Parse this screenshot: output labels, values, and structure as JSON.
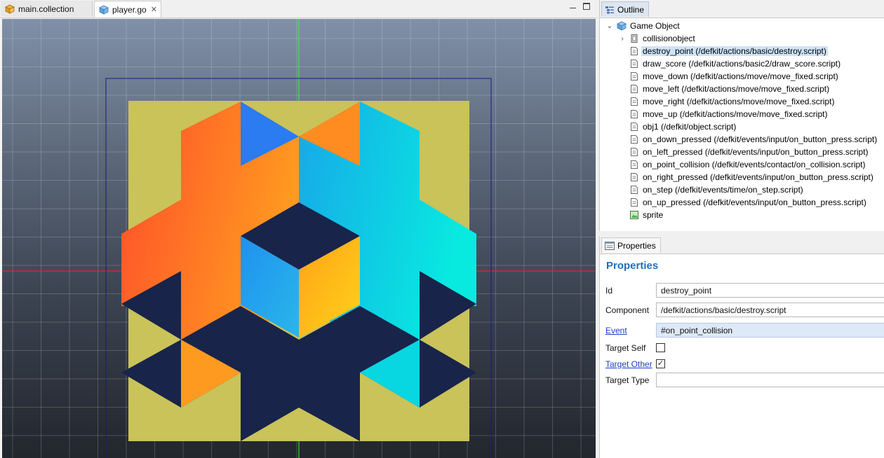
{
  "editor": {
    "tabs": [
      {
        "label": "main.collection",
        "icon": "collection-icon",
        "active": false
      },
      {
        "label": "player.go",
        "icon": "gameobject-icon",
        "active": true,
        "close": "✕"
      }
    ]
  },
  "outline": {
    "tab_label": "Outline",
    "root": "Game Object",
    "items": [
      {
        "label": "collisionobject",
        "icon": "collision-object-icon",
        "expandable": true
      },
      {
        "label": "destroy_point (/defkit/actions/basic/destroy.script)",
        "icon": "script-icon",
        "selected": true
      },
      {
        "label": "draw_score (/defkit/actions/basic2/draw_score.script)",
        "icon": "script-icon"
      },
      {
        "label": "move_down (/defkit/actions/move/move_fixed.script)",
        "icon": "script-icon"
      },
      {
        "label": "move_left (/defkit/actions/move/move_fixed.script)",
        "icon": "script-icon"
      },
      {
        "label": "move_right (/defkit/actions/move/move_fixed.script)",
        "icon": "script-icon"
      },
      {
        "label": "move_up (/defkit/actions/move/move_fixed.script)",
        "icon": "script-icon"
      },
      {
        "label": "obj1 (/defkit/object.script)",
        "icon": "script-icon"
      },
      {
        "label": "on_down_pressed (/defkit/events/input/on_button_press.script)",
        "icon": "script-icon"
      },
      {
        "label": "on_left_pressed (/defkit/events/input/on_button_press.script)",
        "icon": "script-icon"
      },
      {
        "label": "on_point_collision (/defkit/events/contact/on_collision.script)",
        "icon": "script-icon"
      },
      {
        "label": "on_right_pressed (/defkit/events/input/on_button_press.script)",
        "icon": "script-icon"
      },
      {
        "label": "on_step (/defkit/events/time/on_step.script)",
        "icon": "script-icon"
      },
      {
        "label": "on_up_pressed (/defkit/events/input/on_button_press.script)",
        "icon": "script-icon"
      },
      {
        "label": "sprite",
        "icon": "sprite-icon"
      }
    ]
  },
  "properties": {
    "tab_label": "Properties",
    "heading": "Properties",
    "id_label": "Id",
    "id_value": "destroy_point",
    "component_label": "Component",
    "component_value": "/defkit/actions/basic/destroy.script",
    "event_label": "Event",
    "event_value": "#on_point_collision",
    "target_self_label": "Target Self",
    "target_self_checked": false,
    "target_other_label": "Target Other",
    "target_other_checked": true,
    "target_type_label": "Target Type",
    "target_type_value": ""
  },
  "colors": {
    "grid_axis_x": "#ff2020",
    "grid_axis_y": "#30ff30",
    "sprite_background": "#c9c35a",
    "dark_navy": "#18244a",
    "selection": "#cde3f7",
    "heading_blue": "#1f6fb8"
  }
}
